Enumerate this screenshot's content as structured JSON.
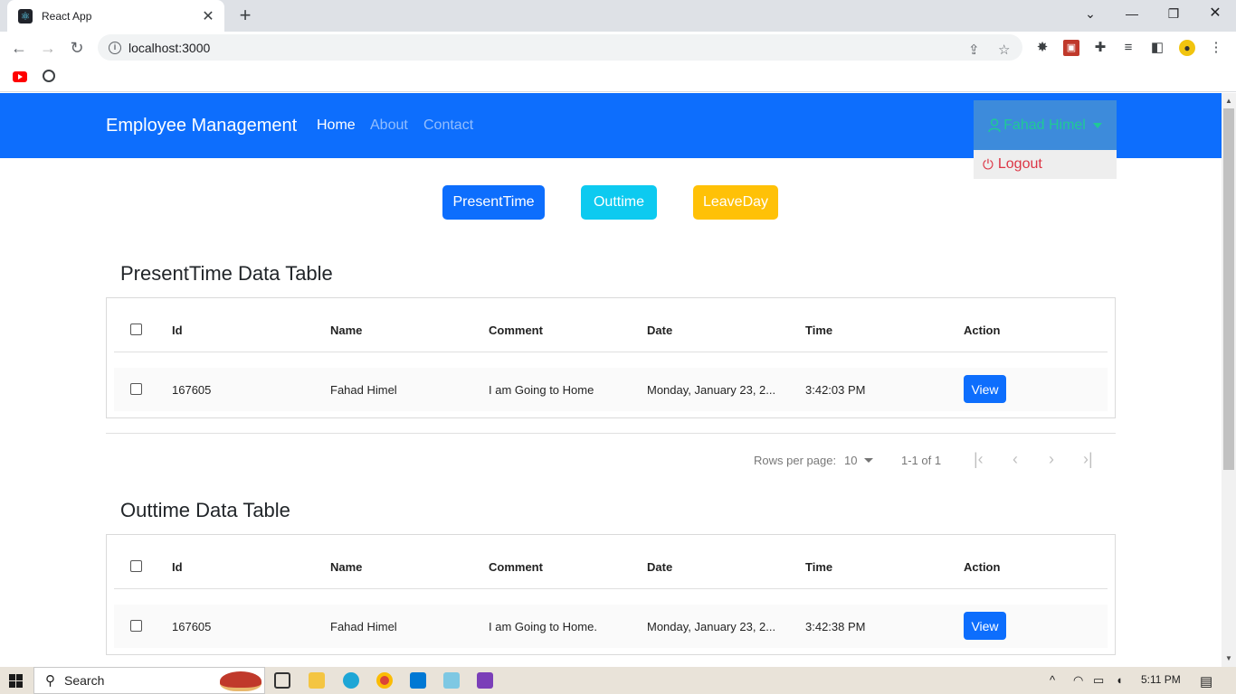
{
  "browser": {
    "tab_title": "React App",
    "url": "localhost:3000",
    "favicon": "react-icon"
  },
  "navbar": {
    "brand": "Employee Management",
    "links": [
      "Home",
      "About",
      "Contact"
    ],
    "active_link": "Home",
    "user_name": "Fahad Himel",
    "dropdown_item": "Logout",
    "bg_color": "#0d6efd"
  },
  "actions": {
    "present_label": "PresentTime",
    "outtime_label": "Outtime",
    "leaveday_label": "LeaveDay"
  },
  "present_table": {
    "title": "PresentTime Data Table",
    "columns": [
      "Id",
      "Name",
      "Comment",
      "Date",
      "Time",
      "Action"
    ],
    "rows": [
      {
        "id": "167605",
        "name": "Fahad Himel",
        "comment": "I am Going to Home",
        "date": "Monday, January 23, 2...",
        "time": "3:42:03 PM",
        "action": "View"
      }
    ],
    "pagination": {
      "rows_per_page_label": "Rows per page:",
      "rows_per_page": "10",
      "range": "1-1 of 1"
    }
  },
  "outtime_table": {
    "title": "Outtime Data Table",
    "columns": [
      "Id",
      "Name",
      "Comment",
      "Date",
      "Time",
      "Action"
    ],
    "rows": [
      {
        "id": "167605",
        "name": "Fahad Himel",
        "comment": "I am Going to Home.",
        "date": "Monday, January 23, 2...",
        "time": "3:42:38 PM",
        "action": "View"
      }
    ]
  },
  "taskbar": {
    "search_label": "Search",
    "time": "5:11 PM"
  }
}
